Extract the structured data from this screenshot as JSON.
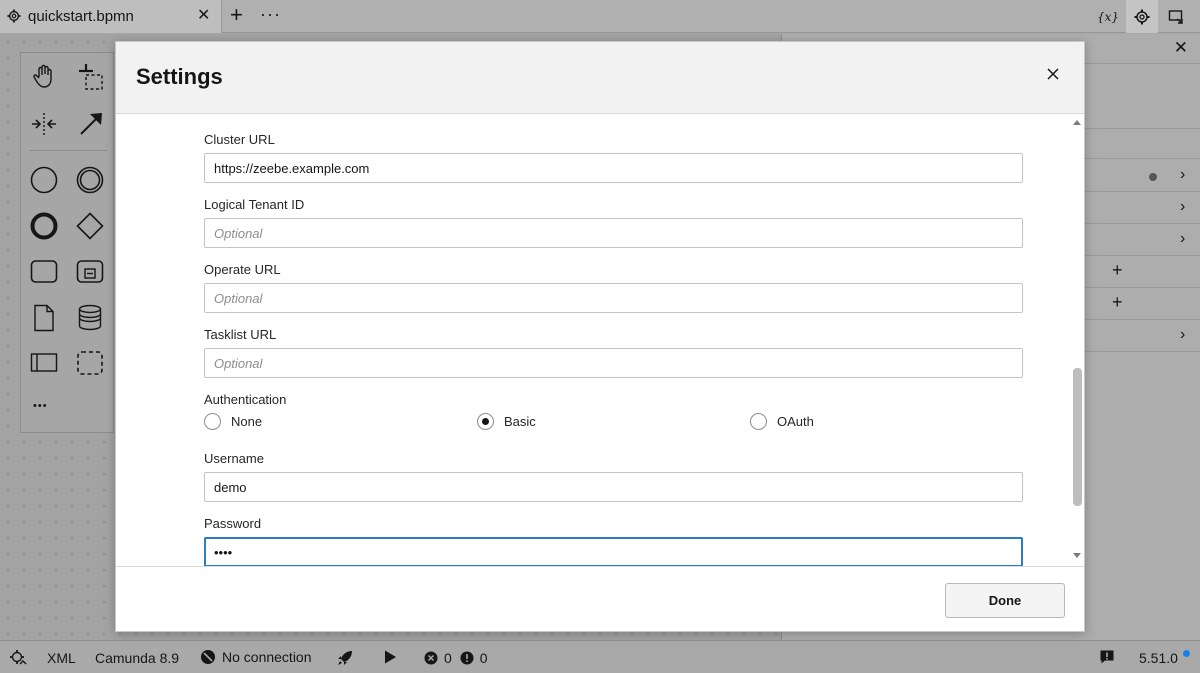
{
  "tabs": {
    "active_tab": {
      "title": "quickstart.bpmn",
      "icon": "gear-icon"
    },
    "add_icon": "plus-icon",
    "more_icon": "ellipsis-icon"
  },
  "toolbar_right": [
    {
      "name": "variables-icon",
      "glyph": "{x}"
    },
    {
      "name": "settings-icon",
      "active": true
    },
    {
      "name": "deploy-panel-icon"
    }
  ],
  "palette": {
    "tools": [
      "hand-tool-icon",
      "lasso-tool-icon",
      "space-tool-icon",
      "connect-tool-icon",
      "start-event-icon",
      "intermediate-event-icon",
      "end-event-icon",
      "gateway-icon",
      "task-icon",
      "subprocess-icon",
      "data-object-icon",
      "data-store-icon",
      "pool-icon",
      "group-icon",
      "more-tools-icon"
    ],
    "more_glyph": "•••"
  },
  "modal": {
    "title": "Settings",
    "fields": [
      {
        "label": "Cluster URL",
        "value": "https://zeebe.example.com",
        "placeholder": ""
      },
      {
        "label": "Logical Tenant ID",
        "value": "",
        "placeholder": "Optional"
      },
      {
        "label": "Operate URL",
        "value": "",
        "placeholder": "Optional"
      },
      {
        "label": "Tasklist URL",
        "value": "",
        "placeholder": "Optional"
      }
    ],
    "authentication": {
      "label": "Authentication",
      "options": [
        "None",
        "Basic",
        "OAuth"
      ],
      "selected": "Basic"
    },
    "username": {
      "label": "Username",
      "value": "demo"
    },
    "password": {
      "label": "Password",
      "value": "demo"
    },
    "done_label": "Done"
  },
  "statusbar": {
    "xml_label": "XML",
    "engine_label": "Camunda 8.9",
    "connection_label": "No connection",
    "errors_count": "0",
    "warnings_count": "0",
    "version": "5.51.0"
  },
  "colors": {
    "focus": "#2d7ac6",
    "notification_dot": "#1a80e6"
  }
}
